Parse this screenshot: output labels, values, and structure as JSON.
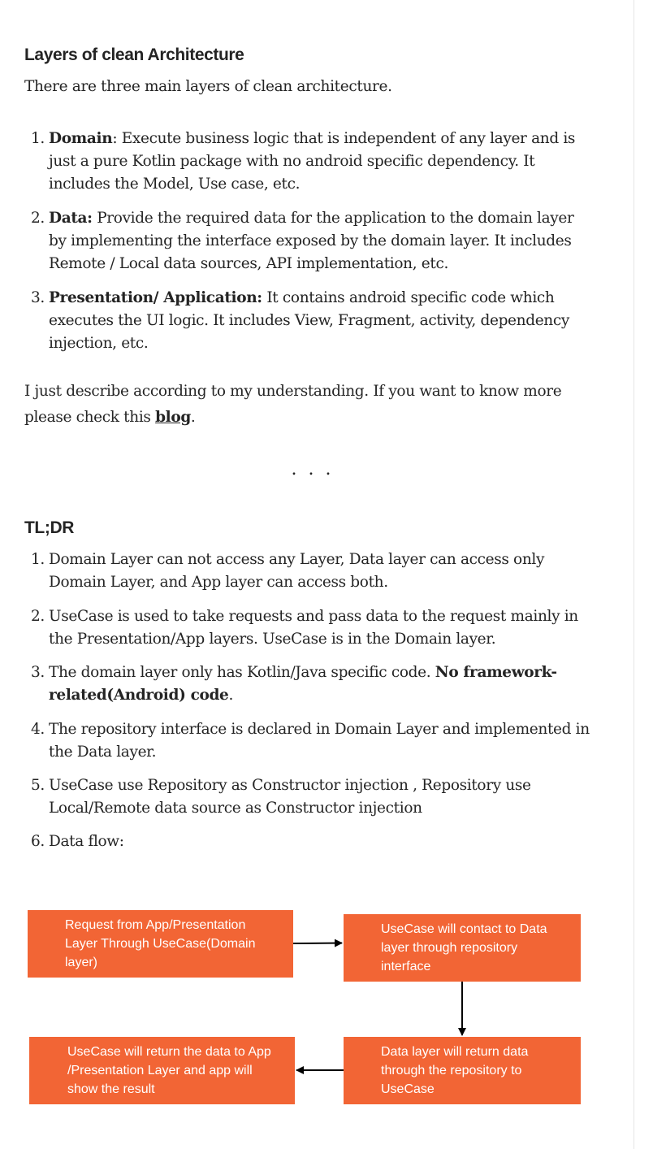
{
  "section1": {
    "heading": "Layers of clean Architecture",
    "intro": "There are three main layers of clean architecture.",
    "items": [
      {
        "number": "1.",
        "term": "Domain",
        "sep": ": ",
        "text": "Execute business logic that is independent of any layer and is just a pure Kotlin package with no android specific dependency. It includes the Model, Use case, etc."
      },
      {
        "number": "2.",
        "term": "Data:",
        "sep": " ",
        "text": "Provide the required data for the application to the domain layer by implementing the interface exposed by the domain layer. It includes Remote / Local data sources, API implementation, etc."
      },
      {
        "number": "3.",
        "term": "Presentation/ Application:",
        "sep": " ",
        "text": "It contains android specific code which executes the UI logic. It includes View, Fragment, activity, dependency injection, etc."
      }
    ],
    "note_before_link": "I just describe according to my understanding. If you want to know more please check this ",
    "link_text": "blog",
    "note_after_link": "."
  },
  "separator": "...",
  "section2": {
    "heading": "TL;DR",
    "items": [
      {
        "number": "1.",
        "text": "Domain Layer can not access any Layer, Data layer can access only Domain Layer, and App layer can access both."
      },
      {
        "number": "2.",
        "text": "UseCase is used to take requests and pass data to the request mainly in the Presentation/App layers. UseCase is in the Domain layer."
      },
      {
        "number": "3.",
        "text": "The domain layer only has Kotlin/Java specific code. ",
        "bold": "No framework-related(Android) code",
        "after": "."
      },
      {
        "number": "4.",
        "text": "The repository interface is declared in Domain Layer and implemented in the Data layer."
      },
      {
        "number": "5.",
        "text": "UseCase use Repository as Constructor injection , Repository use Local/Remote data source as Constructor injection"
      },
      {
        "number": "6.",
        "text": "Data flow:"
      }
    ]
  },
  "diagram": {
    "box_color": "#f26535",
    "boxes": [
      {
        "lines": [
          "Request from App/Presentation",
          "Layer Through UseCase(Domain",
          "layer)"
        ]
      },
      {
        "lines": [
          "UseCase will contact to Data",
          "layer through repository",
          "interface"
        ]
      },
      {
        "lines": [
          "Data layer will return data",
          "through the repository to",
          "UseCase"
        ]
      },
      {
        "lines": [
          "UseCase will return the data to App",
          "/Presentation Layer and app will",
          "show the result"
        ]
      }
    ]
  }
}
